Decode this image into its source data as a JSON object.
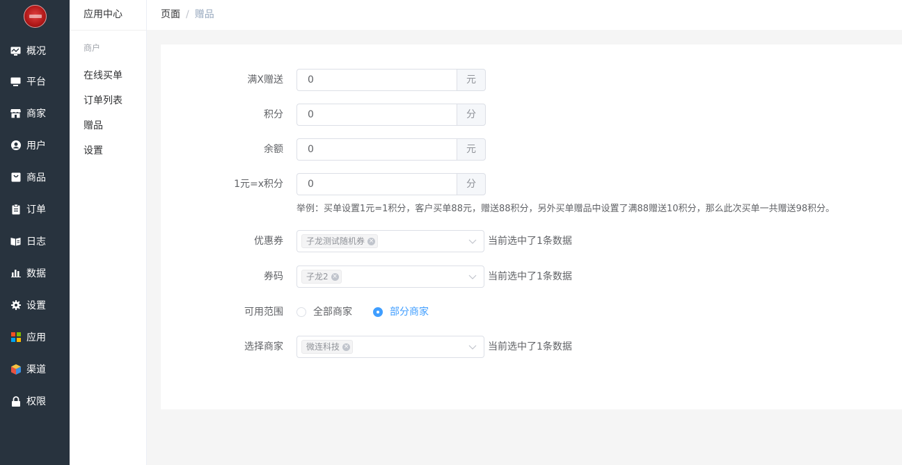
{
  "nav": {
    "items": [
      {
        "label": "概况",
        "icon": "monitor-chart-icon"
      },
      {
        "label": "平台",
        "icon": "desktop-icon"
      },
      {
        "label": "商家",
        "icon": "store-icon"
      },
      {
        "label": "用户",
        "icon": "user-icon"
      },
      {
        "label": "商品",
        "icon": "bag-icon"
      },
      {
        "label": "订单",
        "icon": "clipboard-icon"
      },
      {
        "label": "日志",
        "icon": "book-icon"
      },
      {
        "label": "数据",
        "icon": "bar-chart-icon"
      },
      {
        "label": "设置",
        "icon": "gear-icon"
      },
      {
        "label": "应用",
        "icon": "apps-grid-icon"
      },
      {
        "label": "渠道",
        "icon": "cube-icon"
      },
      {
        "label": "权限",
        "icon": "lock-icon"
      }
    ]
  },
  "subnav": {
    "title": "应用中心",
    "group": "商户",
    "items": [
      "在线买单",
      "订单列表",
      "赠品",
      "设置"
    ]
  },
  "breadcrumb": {
    "root": "页面",
    "sep": "/",
    "current": "赠品"
  },
  "form": {
    "full_gift": {
      "label": "满X赠送",
      "value": "0",
      "unit": "元"
    },
    "points": {
      "label": "积分",
      "value": "0",
      "unit": "分"
    },
    "balance": {
      "label": "余额",
      "value": "0",
      "unit": "元"
    },
    "rate": {
      "label": "1元=x积分",
      "value": "0",
      "unit": "分"
    },
    "hint": "举例：买单设置1元=1积分，客户买单88元，赠送88积分，另外买单赠品中设置了满88赠送10积分，那么此次买单一共赠送98积分。",
    "coupon": {
      "label": "优惠券",
      "tag": "子龙测试随机券",
      "after": "当前选中了1条数据"
    },
    "code": {
      "label": "券码",
      "tag": "子龙2",
      "after": "当前选中了1条数据"
    },
    "scope": {
      "label": "可用范围",
      "opt_all": "全部商家",
      "opt_part": "部分商家",
      "selected": "部分商家"
    },
    "merchant": {
      "label": "选择商家",
      "tag": "微连科技",
      "after": "当前选中了1条数据"
    }
  },
  "colors": {
    "nav_bg": "#28333e",
    "accent": "#409eff"
  }
}
